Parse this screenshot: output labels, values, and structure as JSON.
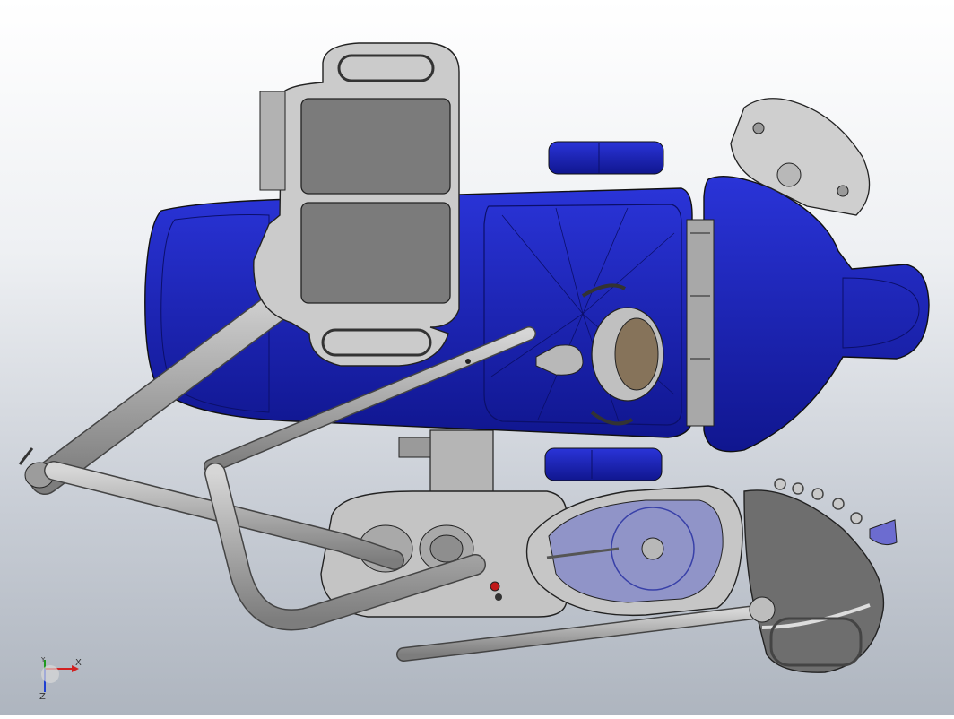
{
  "viewport": {
    "model_view": "dental-chair-assembly-top-view",
    "background": "gradient-white-to-gray",
    "edge_color": "#222222",
    "upholstery_color": "#1a22b8",
    "metal_color": "#8c8c8c"
  },
  "triad": {
    "x_label": "X",
    "y_label": "Y",
    "z_label": "Z",
    "x_color": "#d22020",
    "y_color": "#1f9a1f",
    "z_color": "#1f3fd2"
  }
}
